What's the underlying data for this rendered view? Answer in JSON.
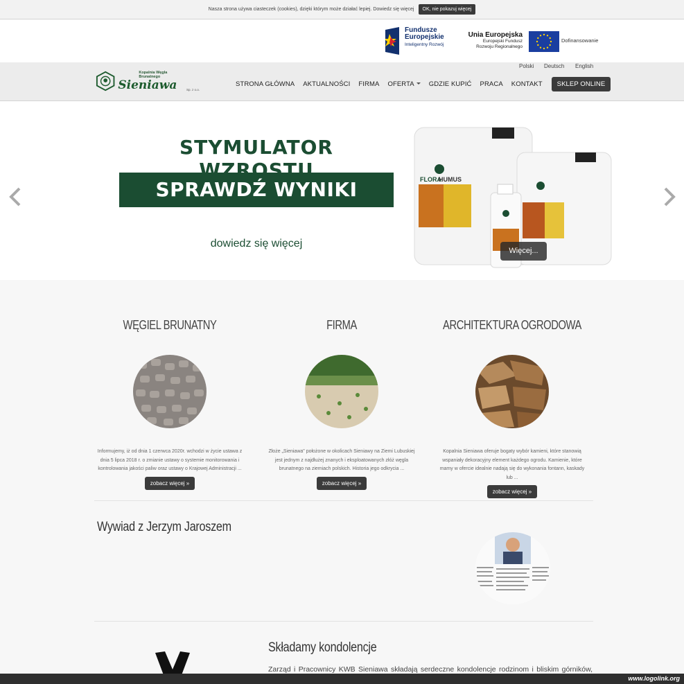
{
  "cookie": {
    "text": "Nasza strona używa ciasteczek (cookies), dzięki którym może działać lepiej. Dowiedz się więcej",
    "ok_label": "OK, nie pokazuj więcej"
  },
  "eu_band": {
    "fe_title1": "Fundusze",
    "fe_title2": "Europejskie",
    "fe_sub": "Inteligentny Rozwój",
    "ue_title": "Unia Europejska",
    "ue_sub1": "Europejski Fundusz",
    "ue_sub2": "Rozwoju Regionalnego",
    "dof": "Dofinansowanie"
  },
  "logo": {
    "small": "Kopalnia Węgla Brunatnego",
    "name": "Sieniawa",
    "suffix": "Sp. z o.o."
  },
  "langs": [
    "Polski",
    "Deutsch",
    "English"
  ],
  "menu": {
    "items": [
      "STRONA GŁÓWNA",
      "AKTUALNOŚCI",
      "FIRMA",
      "OFERTA",
      "GDZIE KUPIĆ",
      "PRACA",
      "KONTAKT"
    ],
    "shop": "SKLEP ONLINE"
  },
  "hero": {
    "line1": "STYMULATOR WZROSTU",
    "line2": "SPRAWDŹ WYNIKI BADAŃ",
    "line3": "dowiedz się więcej",
    "more": "Więcej...",
    "product_flora": "FLORA",
    "product_humus": "HUMUS"
  },
  "features": [
    {
      "title": "WĘGIEL BRUNATNY",
      "text": "Informujemy, iż od dnia 1 czerwca 2020r. wchodzi w życie ustawa z dnia 5 lipca 2018 r. o zmianie ustawy o systemie monitorowania i kontrolowania jakości paliw oraz ustawy o Krajowej Administracji ...",
      "more": "zobacz więcej »"
    },
    {
      "title": "FIRMA",
      "text": "Złoże „Sieniawa\" położone w okolicach Sieniawy na Ziemi Lubuskiej jest jednym z najdłużej znanych i eksploatowanych złóż węgla brunatnego na ziemiach polskich. Historia jego odkrycia ...",
      "more": "zobacz więcej »"
    },
    {
      "title": "ARCHITEKTURA OGRODOWA",
      "text": "Kopalnia Sieniawa oferuje bogaty wybór kamieni, które stanowią wspaniały dekoracyjny element każdego ogrodu. Kamienie, które mamy w ofercie idealnie nadają się do wykonania fontann, kaskady lub ...",
      "more": "zobacz więcej »"
    }
  ],
  "interview": {
    "title": "Wywiad z Jerzym Jaroszem"
  },
  "condolences": {
    "title": "Składamy kondolencje",
    "text": "Zarząd i Pracownicy KWB Sieniawa składają serdeczne kondolencje rodzinom i bliskim górników, którzy zginęli w tragicznym wypadku w kopalni w Karwinie. Jest nam szczególnie przykro, że w tym przedświątecznym czas, musieliśmy"
  },
  "footer": {
    "watermark": "www.logolink.org"
  },
  "colors": {
    "brand_green": "#1b4d32",
    "dark_button": "#3b3b3b",
    "eu_blue": "#1a3ea0"
  }
}
